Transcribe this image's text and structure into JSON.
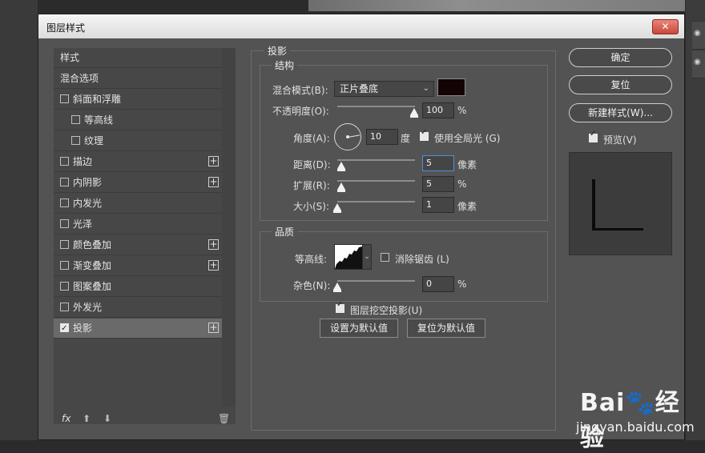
{
  "window": {
    "title": "图层样式",
    "close_symbol": "✕"
  },
  "styles_list": {
    "items": [
      {
        "label": "样式",
        "type": "header"
      },
      {
        "label": "混合选项",
        "type": "header"
      },
      {
        "label": "斜面和浮雕",
        "checked": false,
        "indent": 0,
        "plus": false
      },
      {
        "label": "等高线",
        "checked": false,
        "indent": 1,
        "plus": false
      },
      {
        "label": "纹理",
        "checked": false,
        "indent": 1,
        "plus": false
      },
      {
        "label": "描边",
        "checked": false,
        "indent": 0,
        "plus": true
      },
      {
        "label": "内阴影",
        "checked": false,
        "indent": 0,
        "plus": true
      },
      {
        "label": "内发光",
        "checked": false,
        "indent": 0,
        "plus": false
      },
      {
        "label": "光泽",
        "checked": false,
        "indent": 0,
        "plus": false
      },
      {
        "label": "颜色叠加",
        "checked": false,
        "indent": 0,
        "plus": true
      },
      {
        "label": "渐变叠加",
        "checked": false,
        "indent": 0,
        "plus": true
      },
      {
        "label": "图案叠加",
        "checked": false,
        "indent": 0,
        "plus": false
      },
      {
        "label": "外发光",
        "checked": false,
        "indent": 0,
        "plus": false
      },
      {
        "label": "投影",
        "checked": true,
        "indent": 0,
        "plus": true,
        "selected": true
      }
    ],
    "footer": {
      "fx": "fx",
      "up": "⬆",
      "down": "⬇",
      "trash": "🗑"
    }
  },
  "drop_shadow": {
    "section_title": "投影",
    "structure": {
      "legend": "结构",
      "blend_mode_label": "混合模式(B):",
      "blend_mode_value": "正片叠底",
      "shadow_color": "#130303",
      "opacity_label": "不透明度(O):",
      "opacity_value": "100",
      "opacity_unit": "%",
      "opacity_slider": 1.0,
      "angle_label": "角度(A):",
      "angle_value": "10",
      "angle_unit": "度",
      "global_light_label": "使用全局光 (G)",
      "global_light_checked": true,
      "distance_label": "距离(D):",
      "distance_value": "5",
      "distance_unit": "像素",
      "spread_label": "扩展(R):",
      "spread_value": "5",
      "spread_unit": "%",
      "size_label": "大小(S):",
      "size_value": "1",
      "size_unit": "像素"
    },
    "quality": {
      "legend": "品质",
      "contour_label": "等高线:",
      "anti_alias_label": "消除锯齿 (L)",
      "anti_alias_checked": false,
      "noise_label": "杂色(N):",
      "noise_value": "0",
      "noise_unit": "%"
    },
    "knockout_label": "图层挖空投影(U)",
    "knockout_checked": true,
    "set_default_label": "设置为默认值",
    "reset_default_label": "复位为默认值"
  },
  "right_panel": {
    "ok_label": "确定",
    "reset_label": "复位",
    "new_style_label": "新建样式(W)...",
    "preview_label": "预览(V)",
    "preview_checked": true
  },
  "watermark": {
    "brand": "Bai",
    "brand2": "经验",
    "url": "jingyan.baidu.com"
  }
}
